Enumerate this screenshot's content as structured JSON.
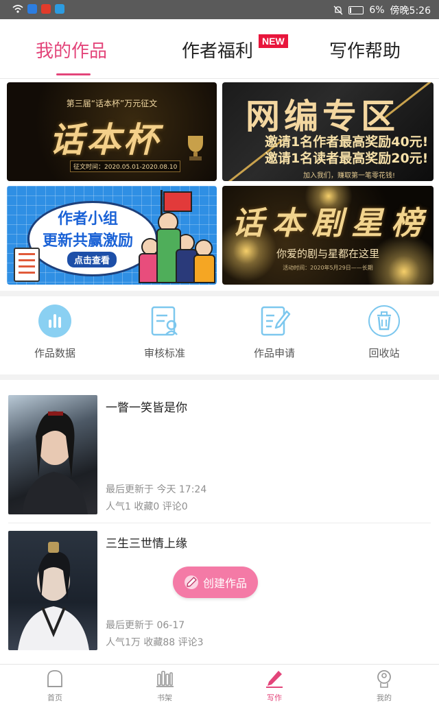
{
  "status_bar": {
    "battery": "6%",
    "time": "傍晚5:26"
  },
  "tabs": [
    {
      "label": "我的作品",
      "active": true
    },
    {
      "label": "作者福利",
      "badge": "NEW"
    },
    {
      "label": "写作帮助"
    }
  ],
  "banners": {
    "huaben": {
      "top": "第三届“话本杯”万元征文",
      "title": "话本杯",
      "date": "征文时间：2020.05.01-2020.08.10"
    },
    "wangbian": {
      "title": "网编专区",
      "line1": "邀请1名作者最高奖励40元!",
      "line2": "邀请1名读者最高奖励20元!",
      "small": "加入我们，赚取第一笔零花钱!"
    },
    "group": {
      "line1": "作者小组",
      "line2": "更新共赢激励",
      "button": "点击查看"
    },
    "drama": {
      "title": "话本剧星榜",
      "sub": "你爱的剧与星都在这里",
      "small": "活动时间：2020年5月29日——长期"
    }
  },
  "tools": [
    {
      "label": "作品数据",
      "icon": "bar-chart-icon"
    },
    {
      "label": "审核标准",
      "icon": "review-icon"
    },
    {
      "label": "作品申请",
      "icon": "edit-document-icon"
    },
    {
      "label": "回收站",
      "icon": "trash-icon"
    }
  ],
  "works": [
    {
      "title": "一瞥一笑皆是你",
      "updated": "最后更新于 今天 17:24",
      "stats": "人气1 收藏0 评论0"
    },
    {
      "title": "三生三世情上缘",
      "updated": "最后更新于 06-17",
      "stats": "人气1万 收藏88 评论3"
    }
  ],
  "create_button": "创建作品",
  "bottom_nav": [
    {
      "label": "首页",
      "icon": "home-icon"
    },
    {
      "label": "书架",
      "icon": "bookshelf-icon"
    },
    {
      "label": "写作",
      "icon": "pen-icon",
      "active": true
    },
    {
      "label": "我的",
      "icon": "profile-icon"
    }
  ],
  "colors": {
    "accent": "#e3457a",
    "badge": "#e8163c",
    "tool_icon": "#7cc7ee",
    "create_button": "#f47aa6"
  }
}
